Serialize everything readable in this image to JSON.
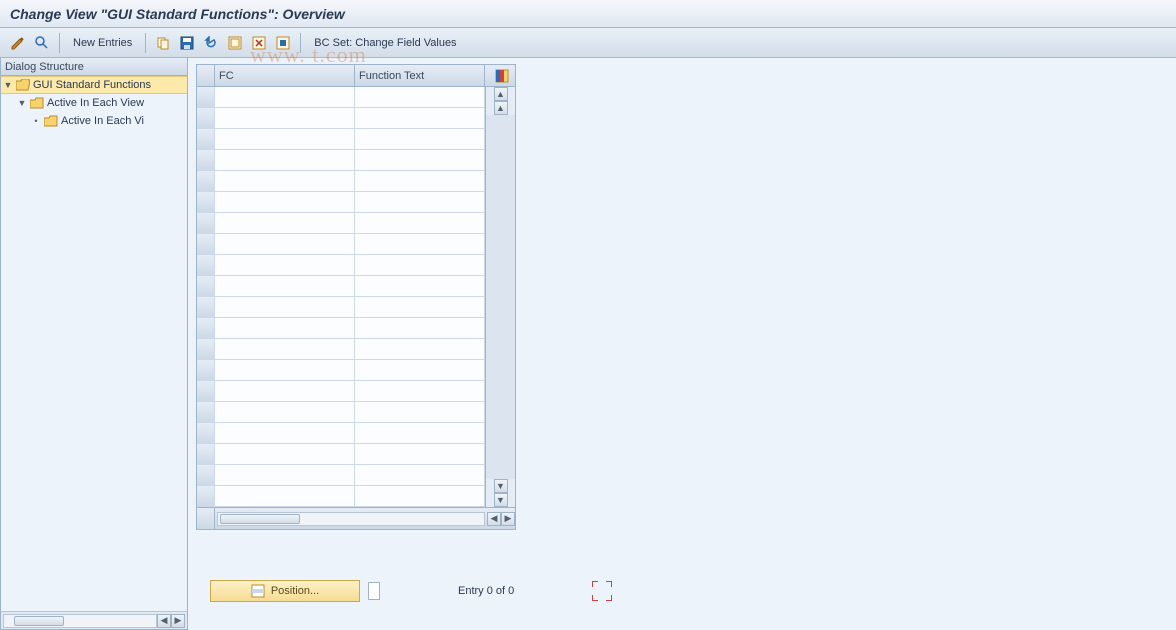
{
  "title": "Change View \"GUI Standard Functions\": Overview",
  "toolbar": {
    "new_entries": "New Entries",
    "bcset": "BC Set: Change Field Values"
  },
  "tree": {
    "header": "Dialog Structure",
    "nodes": [
      {
        "label": "GUI Standard Functions",
        "selected": true
      },
      {
        "label": "Active In Each View"
      },
      {
        "label": "Active In Each Vi"
      }
    ]
  },
  "grid": {
    "col1": "FC",
    "col2": "Function Text"
  },
  "footer": {
    "position_btn": "Position...",
    "entry_text": "Entry 0 of 0"
  },
  "watermark": "www.                       t.com"
}
